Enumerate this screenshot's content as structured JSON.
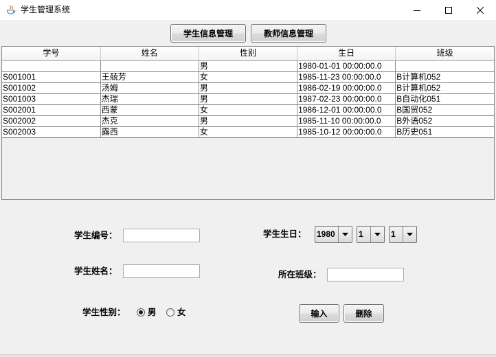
{
  "window": {
    "title": "学生管理系统",
    "app_icon": "java-coffee-cup-icon",
    "controls": {
      "minimize": "minimize-icon",
      "maximize": "maximize-icon",
      "close": "close-icon"
    }
  },
  "nav": {
    "student_info_button": "学生信息管理",
    "teacher_info_button": "教师信息管理"
  },
  "table": {
    "columns": [
      "学号",
      "姓名",
      "性别",
      "生日",
      "班级"
    ],
    "rows": [
      [
        "",
        "",
        "男",
        "1980-01-01 00:00:00.0",
        ""
      ],
      [
        "S001001",
        "王兢芳",
        "女",
        "1985-11-23 00:00:00.0",
        "B计算机052"
      ],
      [
        "S001002",
        "汤姆",
        "男",
        "1986-02-19 00:00:00.0",
        "B计算机052"
      ],
      [
        "S001003",
        "杰瑞",
        "男",
        "1987-02-23 00:00:00.0",
        "B自动化051"
      ],
      [
        "S002001",
        "西蒙",
        "女",
        "1986-12-01 00:00:00.0",
        "B国贸052"
      ],
      [
        "S002002",
        "杰克",
        "男",
        "1985-11-10 00:00:00.0",
        "B外语052"
      ],
      [
        "S002003",
        "露西",
        "女",
        "1985-10-12 00:00:00.0",
        "B历史051"
      ]
    ]
  },
  "form": {
    "student_id": {
      "label": "学生编号：",
      "value": ""
    },
    "student_name": {
      "label": "学生姓名：",
      "value": ""
    },
    "gender": {
      "label": "学生性别：",
      "options": [
        "男",
        "女"
      ],
      "selected_index": 0
    },
    "birthday": {
      "label": "学生生日：",
      "year": "1980",
      "month": "1",
      "day": "1",
      "dropdown_icon": "triangle-down-icon"
    },
    "class_name": {
      "label": "所在班级：",
      "value": ""
    }
  },
  "actions": {
    "submit_button": "输入",
    "delete_button": "删除"
  },
  "colors": {
    "panel_bg": "#F0F0F0",
    "title_bar_bg": "#FFFFFF",
    "table_grid": "#8C8C8C",
    "field_border": "#ABADB3"
  }
}
